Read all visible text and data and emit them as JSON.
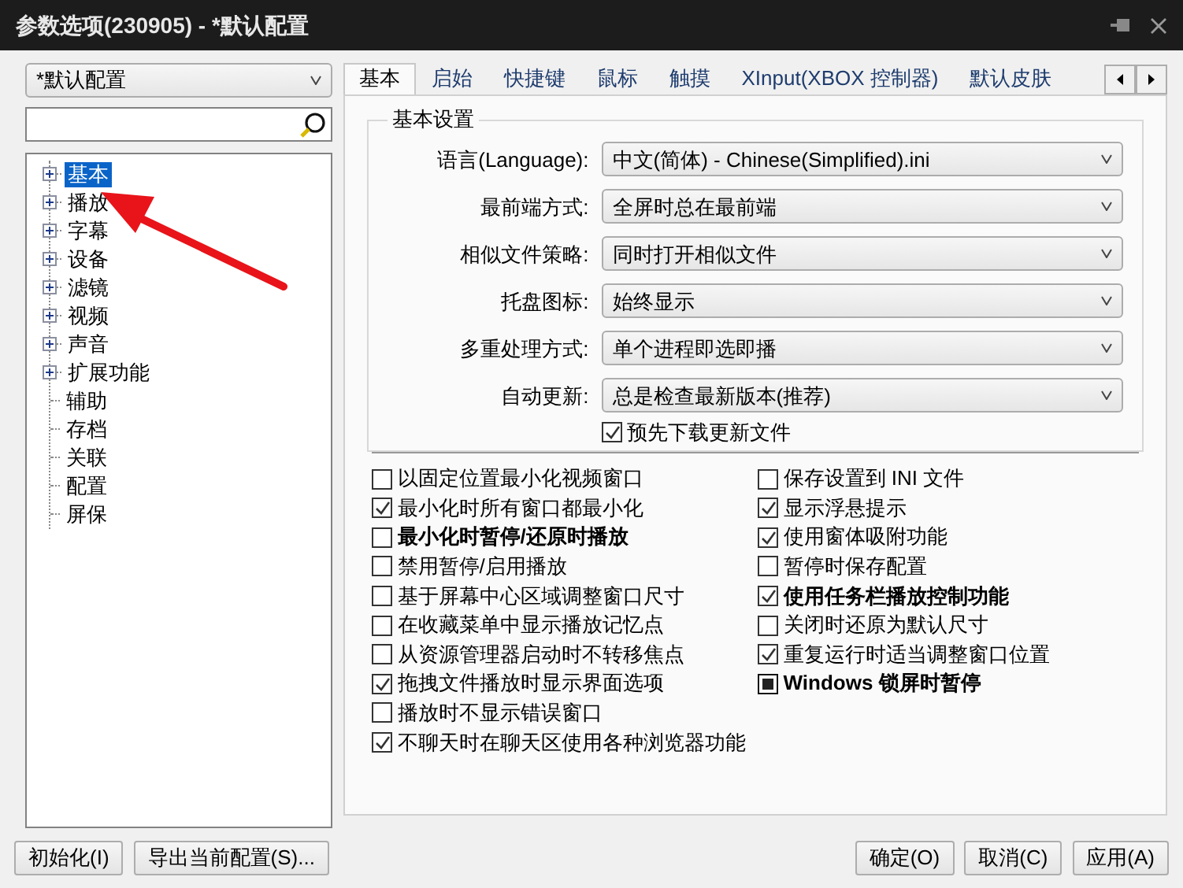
{
  "window": {
    "title": "参数选项(230905) - *默认配置"
  },
  "profile_select": {
    "value": "*默认配置"
  },
  "tree": [
    {
      "label": "基本",
      "kind": "folder",
      "expanded": false,
      "selected": true
    },
    {
      "label": "播放",
      "kind": "folder",
      "expanded": false,
      "selected": false
    },
    {
      "label": "字幕",
      "kind": "folder",
      "expanded": false,
      "selected": false
    },
    {
      "label": "设备",
      "kind": "folder",
      "expanded": false,
      "selected": false
    },
    {
      "label": "滤镜",
      "kind": "folder",
      "expanded": false,
      "selected": false
    },
    {
      "label": "视频",
      "kind": "folder",
      "expanded": false,
      "selected": false
    },
    {
      "label": "声音",
      "kind": "folder",
      "expanded": false,
      "selected": false
    },
    {
      "label": "扩展功能",
      "kind": "folder",
      "expanded": false,
      "selected": false
    },
    {
      "label": "辅助",
      "kind": "leaf",
      "selected": false
    },
    {
      "label": "存档",
      "kind": "leaf",
      "selected": false
    },
    {
      "label": "关联",
      "kind": "leaf",
      "selected": false
    },
    {
      "label": "配置",
      "kind": "leaf",
      "selected": false
    },
    {
      "label": "屏保",
      "kind": "leaf",
      "selected": false
    }
  ],
  "tabs": [
    {
      "label": "基本",
      "selected": true
    },
    {
      "label": "启始",
      "selected": false
    },
    {
      "label": "快捷键",
      "selected": false
    },
    {
      "label": "鼠标",
      "selected": false
    },
    {
      "label": "触摸",
      "selected": false
    },
    {
      "label": "XInput(XBOX 控制器)",
      "selected": false
    },
    {
      "label": "默认皮肤",
      "selected": false
    }
  ],
  "general": {
    "title": "基本设置",
    "settings": [
      {
        "label": "语言(Language):",
        "value": "中文(简体) - Chinese(Simplified).ini"
      },
      {
        "label": "最前端方式:",
        "value": "全屏时总在最前端"
      },
      {
        "label": "相似文件策略:",
        "value": "同时打开相似文件"
      },
      {
        "label": "托盘图标:",
        "value": "始终显示"
      },
      {
        "label": "多重处理方式:",
        "value": "单个进程即选即播"
      },
      {
        "label": "自动更新:",
        "value": "总是检查最新版本(推荐)"
      }
    ],
    "download_option": {
      "label": "预先下载更新文件",
      "checked": true
    }
  },
  "options": {
    "left": [
      {
        "label": "以固定位置最小化视频窗口",
        "kind": "checkbox",
        "checked": false,
        "bold": false
      },
      {
        "label": "最小化时所有窗口都最小化",
        "kind": "checkbox",
        "checked": true,
        "bold": false
      },
      {
        "label": "最小化时暂停/还原时播放",
        "kind": "checkbox",
        "checked": false,
        "bold": true
      },
      {
        "label": "禁用暂停/启用播放",
        "kind": "checkbox",
        "checked": false,
        "bold": false
      },
      {
        "label": "基于屏幕中心区域调整窗口尺寸",
        "kind": "checkbox",
        "checked": false,
        "bold": false
      },
      {
        "label": "在收藏菜单中显示播放记忆点",
        "kind": "checkbox",
        "checked": false,
        "bold": false
      },
      {
        "label": "从资源管理器启动时不转移焦点",
        "kind": "checkbox",
        "checked": false,
        "bold": false
      },
      {
        "label": "拖拽文件播放时显示界面选项",
        "kind": "checkbox",
        "checked": true,
        "bold": false
      },
      {
        "label": "播放时不显示错误窗口",
        "kind": "checkbox",
        "checked": false,
        "bold": false
      },
      {
        "label": "不聊天时在聊天区使用各种浏览器功能",
        "kind": "checkbox",
        "checked": true,
        "bold": false
      }
    ],
    "right": [
      {
        "label": "保存设置到 INI 文件",
        "kind": "checkbox",
        "checked": false,
        "bold": false
      },
      {
        "label": "显示浮悬提示",
        "kind": "checkbox",
        "checked": true,
        "bold": false
      },
      {
        "label": "使用窗体吸附功能",
        "kind": "checkbox",
        "checked": true,
        "bold": false
      },
      {
        "label": "暂停时保存配置",
        "kind": "checkbox",
        "checked": false,
        "bold": false
      },
      {
        "label": "使用任务栏播放控制功能",
        "kind": "checkbox",
        "checked": true,
        "bold": true
      },
      {
        "label": "关闭时还原为默认尺寸",
        "kind": "checkbox",
        "checked": false,
        "bold": false
      },
      {
        "label": "重复运行时适当调整窗口位置",
        "kind": "checkbox",
        "checked": true,
        "bold": false
      },
      {
        "label": "Windows 锁屏时暂停",
        "kind": "tristate",
        "checked": true,
        "bold": true
      }
    ]
  },
  "footer_left_buttons": [
    "初始化(I)",
    "导出当前配置(S)..."
  ],
  "footer_right_buttons": [
    "确定(O)",
    "取消(C)",
    "应用(A)"
  ]
}
